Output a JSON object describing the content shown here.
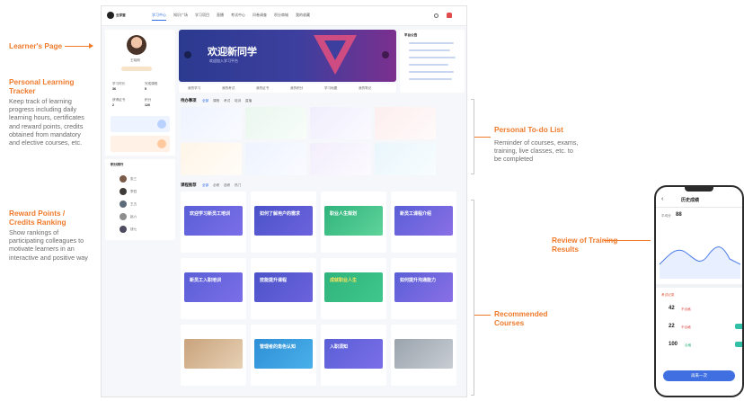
{
  "annotations": {
    "learners_page": "Learner's Page",
    "tracker": {
      "title": "Personal Learning Tracker",
      "text": "Keep track of learning progress including daily learning hours, certificates and reward points, credits obtained from mandatory and elective courses, etc."
    },
    "ranking": {
      "title": "Reward Points / Credits Ranking",
      "text": "Show rankings of participating colleagues to motivate learners in an interactive and positive way"
    },
    "todo": {
      "title": "Personal To-do List",
      "text": "Reminder of courses, exams, training, live classes, etc. to be completed"
    },
    "recommended": {
      "title": "Recommended Courses"
    },
    "review": {
      "title": "Review of Training Results"
    }
  },
  "app": {
    "logo": "云学堂",
    "nav": [
      "学习中心",
      "知识广场",
      "学习项目",
      "直播",
      "考试中心",
      "问卷调查",
      "积分商城",
      "我的收藏"
    ],
    "profile_name": "王晓明",
    "banner_title": "欢迎新同学",
    "banner_sub": "欢迎加入学习平台",
    "ann_title": "平台公告",
    "todo_title": "待办事项",
    "todo_tabs": [
      "全部",
      "课程",
      "考试",
      "培训",
      "直播"
    ],
    "rec_title": "课程推荐",
    "rec_tabs": [
      "全部",
      "必修",
      "选修",
      "热门"
    ],
    "course_thumbs": [
      "欢迎学习新员工培训",
      "如何了解用户的需求",
      "职业人生规划",
      "新员工课程介绍",
      "新员工入职培训",
      "技能提升课程",
      "成就职业人生",
      "如何提升沟通能力",
      "管理者的角色认知",
      "入职须知"
    ],
    "quick_links": [
      "我的学习",
      "我的考试",
      "我的证书",
      "我的积分",
      "学习地图",
      "我的笔记"
    ],
    "tracker_labels": [
      "学习时长",
      "完成课程",
      "获得证书",
      "积分"
    ],
    "tracker_values": [
      "36",
      "5",
      "2",
      "120"
    ],
    "rank_title": "积分排行",
    "rank_names": [
      "张三",
      "李四",
      "王五",
      "赵六",
      "钱七"
    ]
  },
  "phone": {
    "title": "历史成绩",
    "score_label": "平均分",
    "score": "88",
    "list_title": "考试记录",
    "items": [
      {
        "score": "42",
        "tag": "不合格"
      },
      {
        "score": "22",
        "tag": "不合格"
      },
      {
        "score": "100",
        "tag": "合格"
      }
    ],
    "button": "再来一次"
  }
}
